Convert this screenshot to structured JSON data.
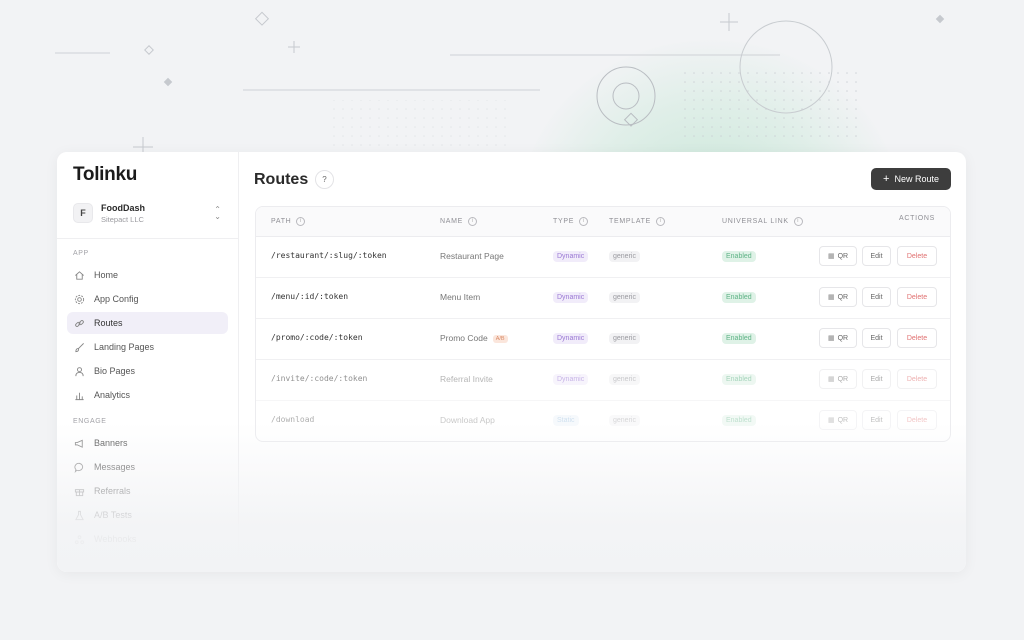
{
  "app": {
    "logo": "Tolinku"
  },
  "workspace": {
    "name": "FoodDash",
    "org": "Sitepact LLC",
    "initial": "F"
  },
  "sidebar": {
    "sections": [
      {
        "label": "APP"
      },
      {
        "label": "ENGAGE"
      }
    ],
    "items": [
      {
        "label": "Home",
        "icon": "home-icon"
      },
      {
        "label": "App Config",
        "icon": "gear-icon"
      },
      {
        "label": "Routes",
        "icon": "link-icon",
        "active": true
      },
      {
        "label": "Landing Pages",
        "icon": "brush-icon"
      },
      {
        "label": "Bio Pages",
        "icon": "user-icon"
      },
      {
        "label": "Analytics",
        "icon": "bar-chart-icon"
      },
      {
        "label": "Banners",
        "icon": "megaphone-icon"
      },
      {
        "label": "Messages",
        "icon": "chat-icon"
      },
      {
        "label": "Referrals",
        "icon": "gift-icon"
      },
      {
        "label": "A/B Tests",
        "icon": "flask-icon"
      },
      {
        "label": "Webhooks",
        "icon": "webhook-icon"
      }
    ]
  },
  "page": {
    "title": "Routes",
    "help": "?",
    "new_button": "New Route"
  },
  "table": {
    "headers": {
      "path": "PATH",
      "name": "NAME",
      "type": "TYPE",
      "template": "TEMPLATE",
      "universal_link": "UNIVERSAL LINK",
      "actions": "ACTIONS"
    },
    "rows": [
      {
        "path": "/restaurant/:slug/:token",
        "name": "Restaurant Page",
        "ab": "",
        "type": "Dynamic",
        "template": "generic",
        "universal_link": "Enabled"
      },
      {
        "path": "/menu/:id/:token",
        "name": "Menu Item",
        "ab": "",
        "type": "Dynamic",
        "template": "generic",
        "universal_link": "Enabled"
      },
      {
        "path": "/promo/:code/:token",
        "name": "Promo Code",
        "ab": "A/B",
        "type": "Dynamic",
        "template": "generic",
        "universal_link": "Enabled"
      },
      {
        "path": "/invite/:code/:token",
        "name": "Referral Invite",
        "ab": "",
        "type": "Dynamic",
        "template": "generic",
        "universal_link": "Enabled"
      },
      {
        "path": "/download",
        "name": "Download App",
        "ab": "",
        "type": "Static",
        "template": "generic",
        "universal_link": "Enabled"
      }
    ],
    "actions": {
      "qr": "QR",
      "edit": "Edit",
      "delete": "Delete"
    }
  },
  "colors": {
    "accent_dark": "#3d3d3d",
    "dynamic": "#9a78d4",
    "static": "#8cb5d8",
    "enabled": "#5fb386",
    "delete": "#e07070",
    "active_nav": "#f1eff8"
  }
}
